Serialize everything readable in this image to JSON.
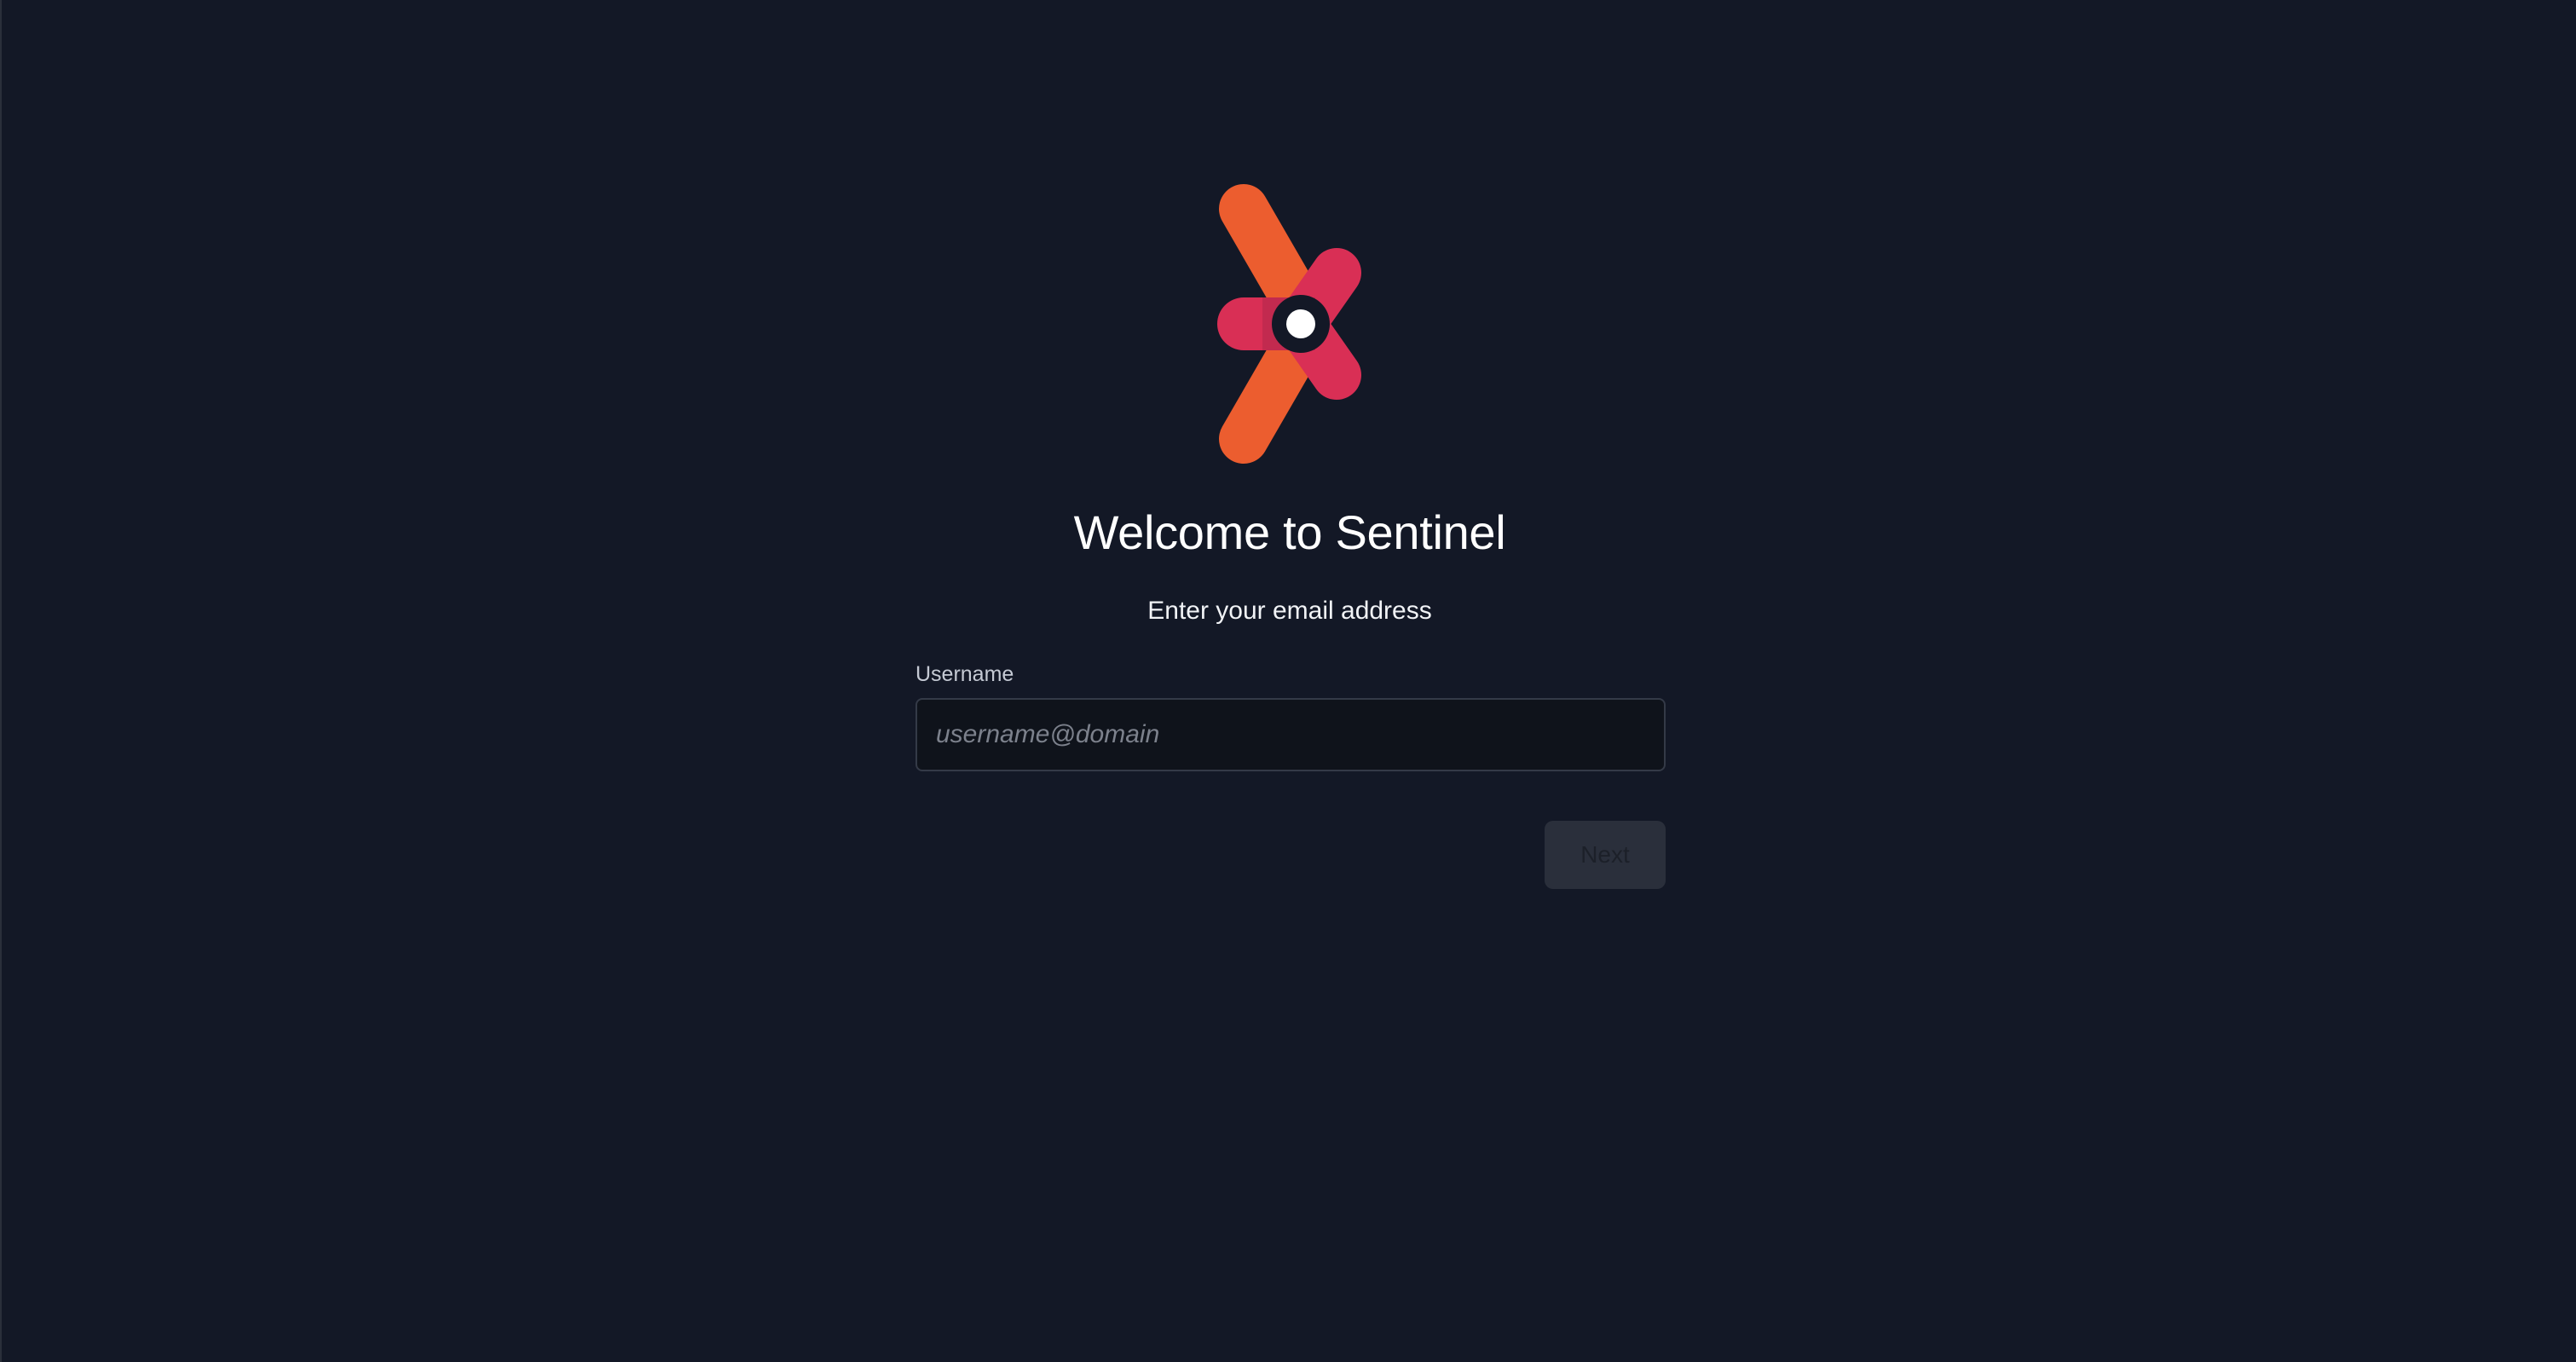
{
  "app": {
    "logo_icon": "sentinel-logo-icon",
    "accent_colors": [
      "#ec5d2f",
      "#d92f55",
      "#ffffff"
    ]
  },
  "header": {
    "title": "Welcome to Sentinel",
    "subtitle": "Enter your email address"
  },
  "form": {
    "username_label": "Username",
    "username_placeholder": "username@domain",
    "username_value": ""
  },
  "actions": {
    "next_label": "Next",
    "next_disabled": true
  }
}
